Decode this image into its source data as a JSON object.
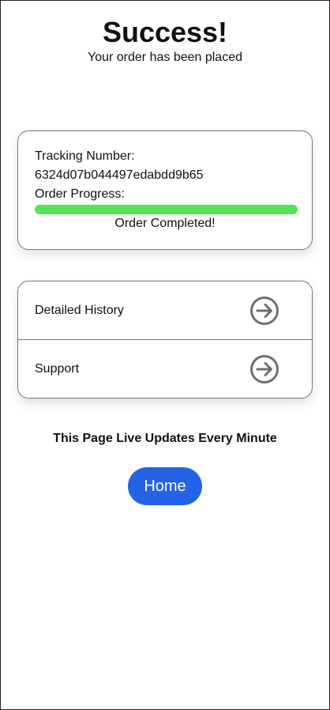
{
  "header": {
    "title": "Success!",
    "subtitle": "Your order has been placed"
  },
  "tracking": {
    "tracking_label": "Tracking Number:",
    "tracking_number": "6324d07b044497edabdd9b65",
    "progress_label": "Order Progress:",
    "progress_percent": 100,
    "status": "Order Completed!"
  },
  "links": [
    {
      "label": "Detailed History",
      "icon": "arrow-right-circle-icon"
    },
    {
      "label": "Support",
      "icon": "arrow-right-circle-icon"
    }
  ],
  "notice": "This Page Live Updates Every Minute",
  "home_button": {
    "label": "Home"
  },
  "colors": {
    "progress": "#57e257",
    "button": "#2563e6",
    "icon": "#6f6f6f",
    "border": "#777777"
  }
}
